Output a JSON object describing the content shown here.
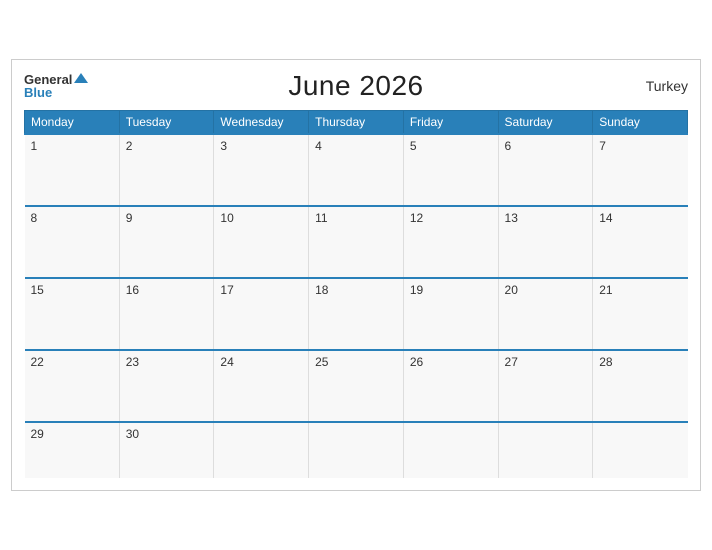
{
  "header": {
    "logo_general": "General",
    "logo_blue": "Blue",
    "title": "June 2026",
    "country": "Turkey"
  },
  "weekdays": [
    "Monday",
    "Tuesday",
    "Wednesday",
    "Thursday",
    "Friday",
    "Saturday",
    "Sunday"
  ],
  "weeks": [
    [
      "1",
      "2",
      "3",
      "4",
      "5",
      "6",
      "7"
    ],
    [
      "8",
      "9",
      "10",
      "11",
      "12",
      "13",
      "14"
    ],
    [
      "15",
      "16",
      "17",
      "18",
      "19",
      "20",
      "21"
    ],
    [
      "22",
      "23",
      "24",
      "25",
      "26",
      "27",
      "28"
    ],
    [
      "29",
      "30",
      "",
      "",
      "",
      "",
      ""
    ]
  ]
}
